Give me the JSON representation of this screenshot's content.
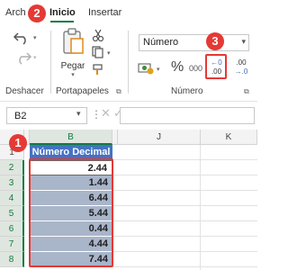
{
  "ribbon_tabs": {
    "file": "Arch",
    "home": "Inicio",
    "insert": "Insertar"
  },
  "groups": {
    "undo": "Deshacer",
    "clipboard": "Portapapeles",
    "number": "Número"
  },
  "clipboard": {
    "paste_label": "Pegar"
  },
  "number_format": {
    "selected": "Número",
    "percent_symbol": "%",
    "thousands_symbol": "000"
  },
  "increase_decimal": {
    "line1": "←0",
    "line2": ".00"
  },
  "decrease_decimal": {
    "line1": ".00",
    "line2": "→.0"
  },
  "formula_bar": {
    "name_box": "B2",
    "formula": ""
  },
  "columns": [
    "B",
    "J",
    "K"
  ],
  "rows": [
    "1",
    "2",
    "3",
    "4",
    "5",
    "6",
    "7",
    "8"
  ],
  "table": {
    "header": "Número Decimal",
    "values": [
      "2.44",
      "1.44",
      "6.44",
      "5.44",
      "0.44",
      "4.44",
      "7.44"
    ]
  },
  "callouts": [
    "1",
    "2",
    "3"
  ],
  "colors": {
    "accent": "#107c41",
    "callout": "#e53935",
    "header_fill": "#4472c4",
    "selection_fill": "#a9b5c9"
  }
}
